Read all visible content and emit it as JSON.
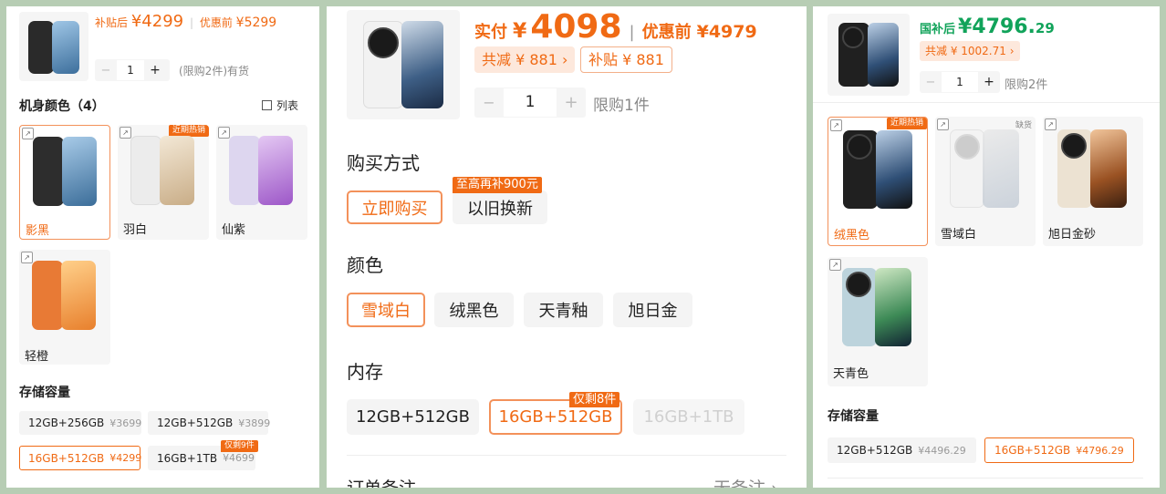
{
  "panel1": {
    "price_prefix": "补贴后",
    "price": "¥4299",
    "orig_prefix": "优惠前",
    "orig_price": "¥5299",
    "qty": "1",
    "minus": "−",
    "plus": "+",
    "limit_text": "(限购2件)有货",
    "color_title": "机身颜色（4）",
    "list_view": "列表",
    "colors": [
      {
        "label": "影黑",
        "badge": ""
      },
      {
        "label": "羽白",
        "badge": "近期热销"
      },
      {
        "label": "仙紫",
        "badge": ""
      },
      {
        "label": "轻橙",
        "badge": ""
      }
    ],
    "storage_title": "存储容量",
    "storage": [
      {
        "label": "12GB+256GB",
        "price": "¥3699",
        "badge": ""
      },
      {
        "label": "12GB+512GB",
        "price": "¥3899",
        "badge": ""
      },
      {
        "label": "16GB+512GB",
        "price": "¥4299",
        "badge": ""
      },
      {
        "label": "16GB+1TB",
        "price": "¥4699",
        "badge": "仅剩9件"
      }
    ]
  },
  "panel2": {
    "price_prefix": "实付",
    "currency": "¥",
    "price": "4098",
    "orig_prefix": "优惠前",
    "orig_price": "¥4979",
    "discount_total": "共减 ¥ 881 ›",
    "subsidy": "补贴 ¥ 881",
    "qty": "1",
    "minus": "−",
    "plus": "+",
    "limit_text": "限购1件",
    "buy_title": "购买方式",
    "buy_options": [
      "立即购买",
      "以旧换新"
    ],
    "tradein_badge": "至高再补900元",
    "color_title": "颜色",
    "colors": [
      "雪域白",
      "绒黑色",
      "天青釉",
      "旭日金"
    ],
    "memory_title": "内存",
    "memory": [
      "12GB+512GB",
      "16GB+512GB",
      "16GB+1TB"
    ],
    "memory_badge": "仅剩8件",
    "note_label": "订单备注",
    "note_value": "无备注 ›"
  },
  "panel3": {
    "price_prefix": "国补后",
    "price_main": "¥4796.",
    "price_dec": "29",
    "discount_total": "共减 ¥ 1002.71 ›",
    "qty": "1",
    "minus": "−",
    "plus": "+",
    "limit_text": "限购2件",
    "colors": [
      {
        "label": "绒黑色",
        "badge": "近期热销"
      },
      {
        "label": "雪域白",
        "badge": "缺货"
      },
      {
        "label": "旭日金砂",
        "badge": ""
      },
      {
        "label": "天青色",
        "badge": ""
      }
    ],
    "storage_title": "存储容量",
    "storage": [
      {
        "label": "12GB+512GB",
        "price": "¥4496.29"
      },
      {
        "label": "16GB+512GB",
        "price": "¥4796.29"
      }
    ]
  }
}
